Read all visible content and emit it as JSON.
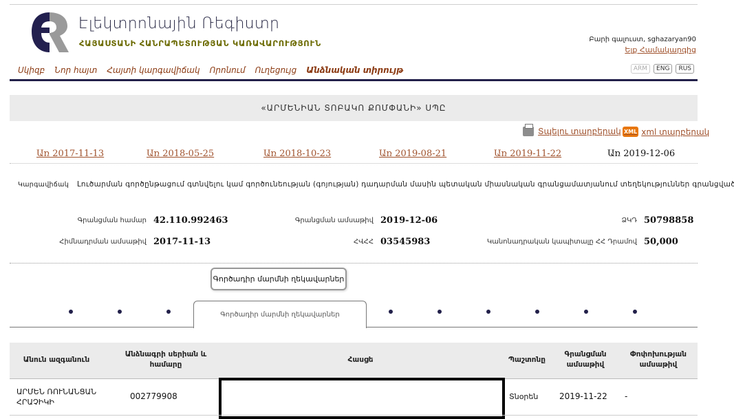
{
  "header": {
    "logo_icon": "er-logo-icon",
    "title": "Էլեկտրոնային Ռեգիստր",
    "subtitle": "ՀԱՅԱՍՏԱՆԻ ՀԱՆՐԱՊԵՏՈՒԹՅԱՆ ԿԱՌԱՎԱՐՈՒԹՅՈՒՆ",
    "greeting": "Բարի գալուստ, sghazaryan90",
    "logout": "Ելք Համակարգից"
  },
  "nav": {
    "items": [
      "Սկիզբ",
      "Նոր հայտ",
      "Հայտի կարգավիճակ",
      "Որոնում",
      "Ուղեցույց",
      "Անձնական տիրույթ"
    ]
  },
  "languages": [
    "ARM",
    "ENG",
    "RUS"
  ],
  "company": {
    "name": "«ԱՐՄԵՆԻԱՆ ՏՈԲԱԿՈ ՔՈՄՓԱՆԻ» ՍՊԸ"
  },
  "actions": {
    "print_label": "Տպելու տարբերակ",
    "xml_badge": "XML",
    "xml_label": "xml տարբերակ"
  },
  "dates": {
    "links": [
      "Առ 2017-11-13",
      "Առ 2018-05-25",
      "Առ 2018-10-23",
      "Առ 2019-08-21",
      "Առ 2019-11-22"
    ],
    "current": "Առ 2019-12-06"
  },
  "notice": {
    "label": "Կարգավիճակ",
    "text": "Լուծարման գործընթացում գտնվելու կամ գործունեության (գոյության) դադարման մասին պետական միասնական գրանցամատյանում տեղեկություններ գրանցված չեն:"
  },
  "info": {
    "reg_number_label": "Գրանցման համար",
    "reg_number": "42.110.992463",
    "reg_date_label": "Գրանցման ամսաթիվ",
    "reg_date": "2019-12-06",
    "tax_id_label": "ՁԿԴ",
    "tax_id": "50798858",
    "founded_label": "Հիմնադրման ամսաթիվ",
    "founded": "2017-11-13",
    "hvhh_label": "ՀՎՀՀ",
    "hvhh": "03545983",
    "capital_label": "Կանոնադրական կապիտալը ՀՀ Դրամով",
    "capital": "50,000"
  },
  "tooltip": "Գործադիր մարմնի ղեկավարներ",
  "tabs": {
    "active_label": "Գործադիր մարմնի ղեկավարներ"
  },
  "table": {
    "headers": [
      "Անուն ազգանուն",
      "Անձնագրի սերիան և համարը",
      "Հասցե",
      "Պաշտոնը",
      "Գրանցման ամսաթիվ",
      "Փոփոխության ամսաթիվ"
    ],
    "rows": [
      [
        "ԱՐՄԵՆ ՌՈՒՆԱՆՑԱՆ ՀՐԱՉԻԿԻ",
        "002779908",
        "",
        "Տնօրեն",
        "2019-11-22",
        "-"
      ]
    ]
  }
}
